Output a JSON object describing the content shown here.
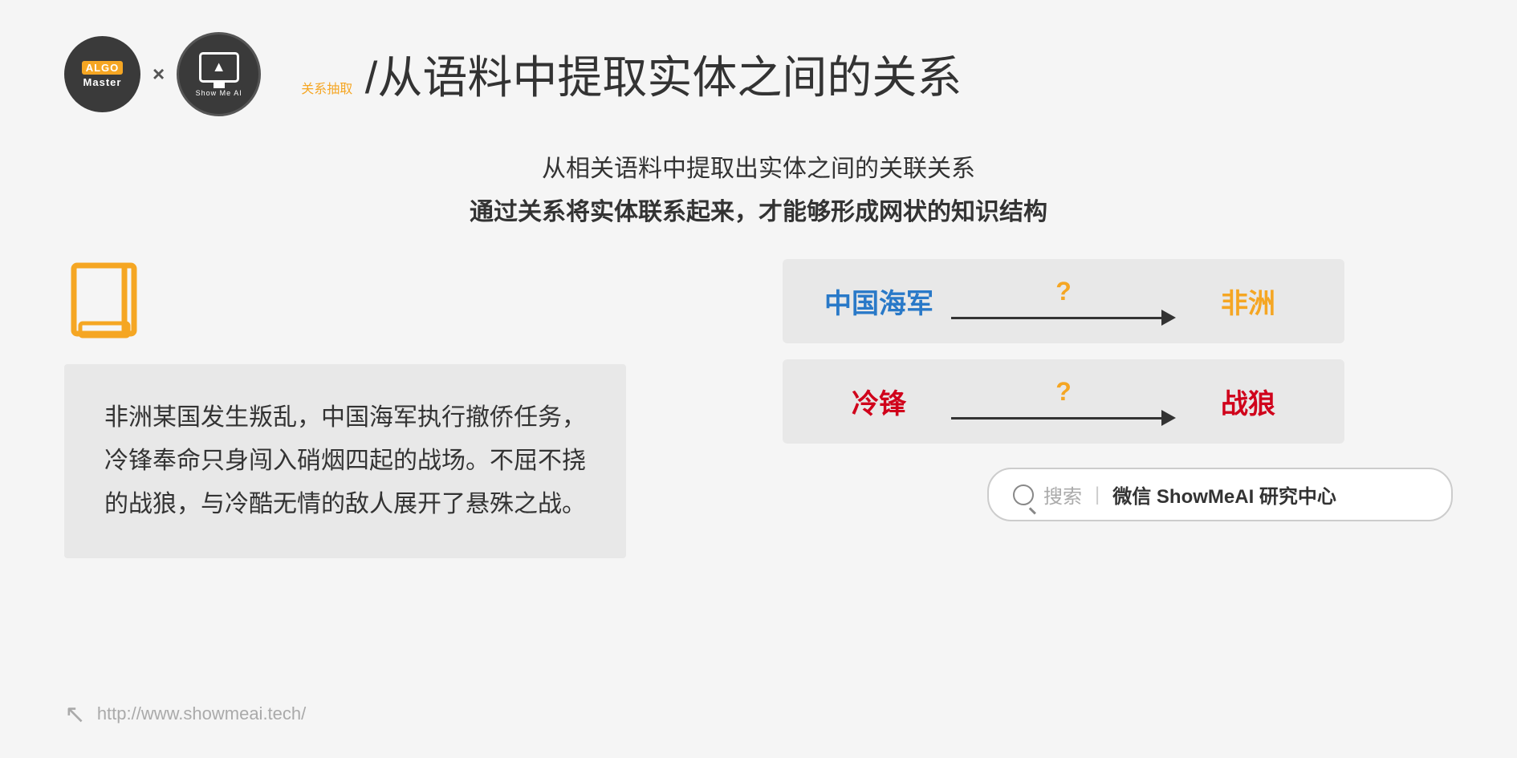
{
  "header": {
    "algo_line1": "ALGO",
    "algo_line2": "Master",
    "x_label": "×",
    "showme_label": "Show Me AI",
    "title_orange": "关系抽取",
    "title_separator": " /",
    "title_dark": "从语料中提取实体之间的关系"
  },
  "subtitle": {
    "line1": "从相关语料中提取出实体之间的关联关系",
    "line2": "通过关系将实体联系起来，才能够形成网状的知识结构"
  },
  "text_content": "非洲某国发生叛乱，中国海军执行撤侨任务，冷锋奉命只身闯入硝烟四起的战场。不屈不挠的战狼，与冷酷无情的敌人展开了悬殊之战。",
  "relations": [
    {
      "entity_left": "中国海军",
      "entity_left_color": "blue",
      "question": "?",
      "entity_right": "非洲",
      "entity_right_color": "orange"
    },
    {
      "entity_left": "冷锋",
      "entity_left_color": "red",
      "question": "?",
      "entity_right": "战狼",
      "entity_right_color": "red"
    }
  ],
  "search": {
    "placeholder": "搜索",
    "divider": "|",
    "brand": "微信 ShowMeAI 研究中心"
  },
  "footer": {
    "url": "http://www.showmeai.tech/"
  }
}
